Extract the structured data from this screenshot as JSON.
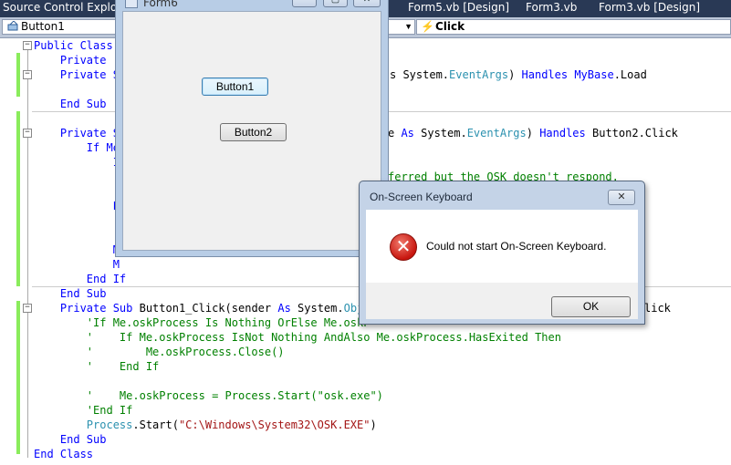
{
  "tabs": [
    {
      "label": "Source Control Explorer"
    },
    {
      "label": "Form5.vb [Design]"
    },
    {
      "label": "Form3.vb"
    },
    {
      "label": "Form3.vb [Design]"
    }
  ],
  "navbar": {
    "object_combo": "Button1",
    "event_combo": "Click"
  },
  "form_designer": {
    "title": "Form6",
    "button1": "Button1",
    "button2": "Button2"
  },
  "dialog": {
    "title": "On-Screen Keyboard",
    "close_glyph": "✕",
    "message": "Could not start On-Screen Keyboard.",
    "ok_label": "OK",
    "error_glyph": "✕"
  },
  "code_lines": [
    "Public Class",
    "    Private ",
    "    Private S",
    "",
    "    End Sub",
    "",
    "    Private S",
    "        If Me",
    "            I",
    "",
    "",
    "            E",
    "",
    "",
    "            M",
    "            M",
    "        End If",
    "    End Sub",
    "",
    "",
    "    Private Sub Button1_Click(sender As System.Obje",
    "        'If Me.oskProcess Is Nothing OrElse Me.oskP",
    "        '    If Me.oskProcess IsNot Nothing AndAlso Me.oskProcess.HasExited Then",
    "        '        Me.oskProcess.Close()",
    "        '    End If",
    "",
    "        '    Me.oskProcess = Process.Start(\"osk.exe\")",
    "        'End If",
    "        Process.Start(\"C:\\Windows\\System32\\OSK.EXE\")",
    "    End Sub",
    "End Class"
  ],
  "code_right": {
    "line3": "s System.EventArgs) Handles MyBase.Load",
    "line7": "e As System.EventArgs) Handles Button2.Click",
    "line10": "ferred but the OSK doesn't respond.",
    "line21": "lick"
  }
}
